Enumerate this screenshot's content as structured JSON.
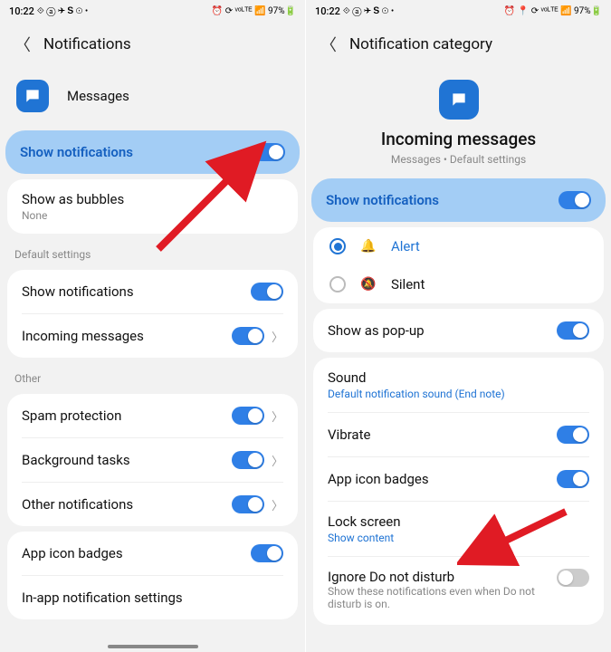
{
  "left": {
    "status": {
      "time": "10:22",
      "icons_left": "⟐ ⓐ ✈ 𝐒 ⊙ •",
      "icons_right": "⏰ ⟳ ᵛᵒᴸᵀᴱ 📶 97%🔋"
    },
    "header": {
      "title": "Notifications"
    },
    "app": {
      "name": "Messages"
    },
    "main_toggle": {
      "label": "Show notifications",
      "on": true
    },
    "bubbles": {
      "label": "Show as bubbles",
      "value": "None"
    },
    "section1_title": "Default settings",
    "defaults": [
      {
        "label": "Show notifications",
        "on": true
      },
      {
        "label": "Incoming messages",
        "on": true
      }
    ],
    "section2_title": "Other",
    "other": [
      {
        "label": "Spam protection",
        "on": true
      },
      {
        "label": "Background tasks",
        "on": true
      },
      {
        "label": "Other notifications",
        "on": true
      }
    ],
    "badges": {
      "label": "App icon badges",
      "on": true
    },
    "inapp": {
      "label": "In-app notification settings"
    }
  },
  "right": {
    "status": {
      "time": "10:22",
      "icons_left": "⟐ ⓐ ✈ 𝐒 ⊙ •",
      "icons_right": "⏰ 📍 ⟳ ᵛᵒᴸᵀᴱ 📶 97%🔋"
    },
    "header": {
      "title": "Notification category"
    },
    "hero": {
      "title": "Incoming messages",
      "sub": "Messages • Default settings"
    },
    "main_toggle": {
      "label": "Show notifications",
      "on": true
    },
    "modes": {
      "alert": "Alert",
      "silent": "Silent"
    },
    "popup": {
      "label": "Show as pop-up",
      "on": true
    },
    "sound": {
      "label": "Sound",
      "value": "Default notification sound (End note)"
    },
    "vibrate": {
      "label": "Vibrate",
      "on": true
    },
    "badges": {
      "label": "App icon badges",
      "on": true
    },
    "lock": {
      "label": "Lock screen",
      "value": "Show content"
    },
    "dnd": {
      "label": "Ignore Do not disturb",
      "sub": "Show these notifications even when Do not disturb is on.",
      "on": false
    }
  }
}
